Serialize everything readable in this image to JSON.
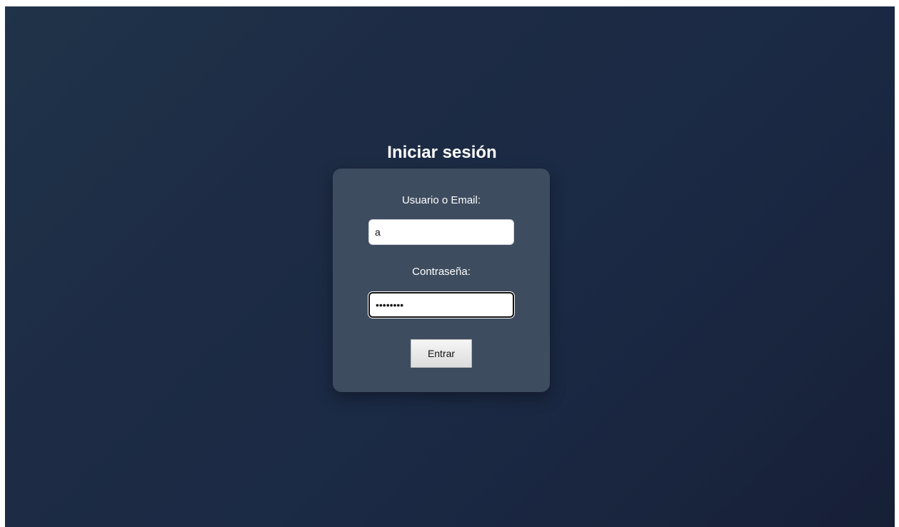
{
  "login": {
    "title": "Iniciar sesión",
    "user_label": "Usuario o Email:",
    "user_value": "a",
    "password_label": "Contraseña:",
    "password_value": "••••••••",
    "submit_label": "Entrar"
  },
  "colors": {
    "background_start": "#1f3349",
    "background_end": "#161f36",
    "card": "#3e4c5f",
    "text": "#ffffff",
    "button": "#e6e6e6"
  }
}
